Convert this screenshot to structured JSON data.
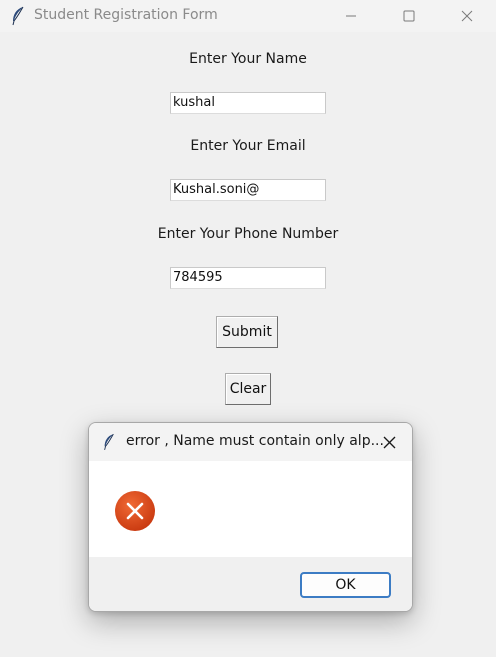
{
  "window": {
    "title": "Student Registration Form"
  },
  "form": {
    "name_label": "Enter Your Name",
    "name_value": "kushal",
    "email_label": "Enter Your Email",
    "email_value": "Kushal.soni@",
    "phone_label": "Enter Your Phone Number",
    "phone_value": "784595",
    "submit_label": "Submit",
    "clear_label": "Clear"
  },
  "dialog": {
    "title": "error , Name must contain only alp...",
    "ok_label": "OK",
    "icon": "error-icon"
  },
  "colors": {
    "error_icon": "#e04c1f",
    "ok_border": "#3c7cc4"
  }
}
